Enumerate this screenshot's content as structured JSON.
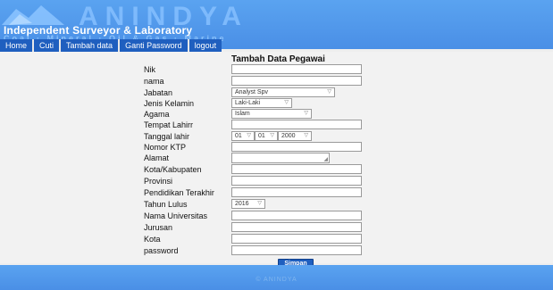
{
  "header": {
    "logo_text": "ANINDYA",
    "company_name": "Independent Surveyor & Laboratory",
    "tagline": "Coal · Mineral · Oil & Gas · Marine"
  },
  "nav": {
    "items": [
      {
        "label": "Home"
      },
      {
        "label": "Cuti"
      },
      {
        "label": "Tambah data"
      },
      {
        "label": "Ganti Password"
      },
      {
        "label": "logout"
      }
    ]
  },
  "form": {
    "title": "Tambah Data Pegawai",
    "fields": {
      "nik": {
        "label": "Nik",
        "value": ""
      },
      "nama": {
        "label": "nama",
        "value": ""
      },
      "jabatan": {
        "label": "Jabatan",
        "value": "Analyst Spv"
      },
      "jenis_kelamin": {
        "label": "Jenis Kelamin",
        "value": "Laki-Laki"
      },
      "agama": {
        "label": "Agama",
        "value": "Islam"
      },
      "tempat_lahir": {
        "label": "Tempat Lahirr",
        "value": ""
      },
      "tanggal_lahir": {
        "label": "Tanggal lahir",
        "day": "01",
        "month": "01",
        "year": "2000"
      },
      "nomor_ktp": {
        "label": "Nomor KTP",
        "value": ""
      },
      "alamat": {
        "label": "Alamat",
        "value": ""
      },
      "kota_kabupaten": {
        "label": "Kota/Kabupaten",
        "value": ""
      },
      "provinsi": {
        "label": "Provinsi",
        "value": ""
      },
      "pendidikan": {
        "label": "Pendidikan Terakhir",
        "value": ""
      },
      "tahun_lulus": {
        "label": "Tahun Lulus",
        "value": "2016"
      },
      "universitas": {
        "label": "Nama Universitas",
        "value": ""
      },
      "jurusan": {
        "label": "Jurusan",
        "value": ""
      },
      "kota": {
        "label": "Kota",
        "value": ""
      },
      "password": {
        "label": "password",
        "value": ""
      }
    },
    "submit_label": "Simpan"
  },
  "footer": {
    "text": "© ANINDYA"
  },
  "colors": {
    "banner": "#5aa3f0",
    "nav_bg": "#1f5fbf",
    "button": "#1f5fbf"
  }
}
